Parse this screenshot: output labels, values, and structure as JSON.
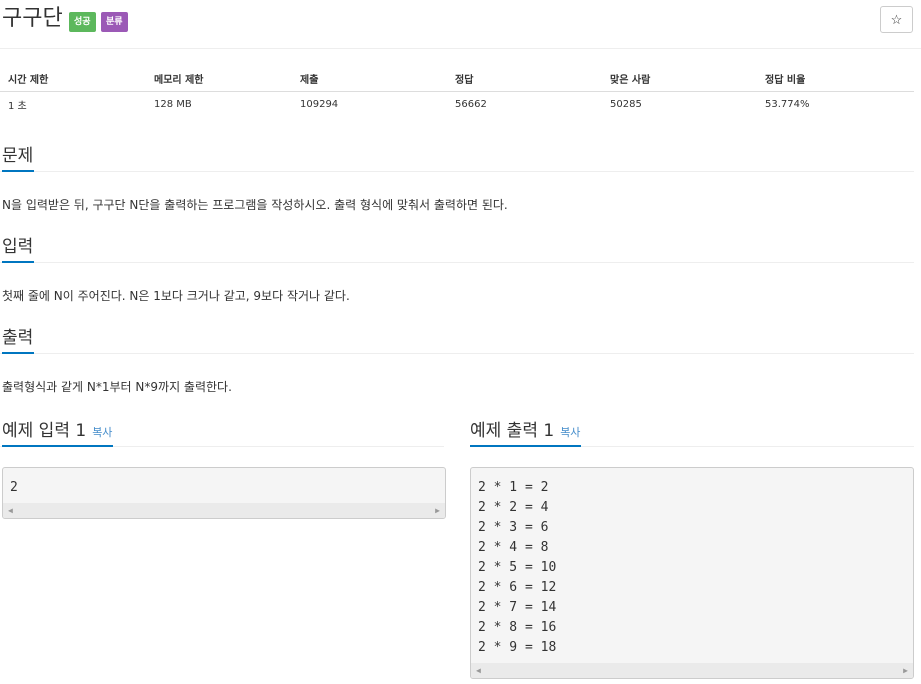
{
  "problem": {
    "title": "구구단",
    "badges": {
      "success": "성공",
      "category": "분류"
    },
    "star": "☆"
  },
  "info_table": {
    "headers": [
      "시간 제한",
      "메모리 제한",
      "제출",
      "정답",
      "맞은 사람",
      "정답 비율"
    ],
    "values": [
      "1 초",
      "128 MB",
      "109294",
      "56662",
      "50285",
      "53.774%"
    ]
  },
  "sections": {
    "description": {
      "title": "문제",
      "text": "N을 입력받은 뒤, 구구단 N단을 출력하는 프로그램을 작성하시오. 출력 형식에 맞춰서 출력하면 된다."
    },
    "input": {
      "title": "입력",
      "text": "첫째 줄에 N이 주어진다. N은 1보다 크거나 같고, 9보다 작거나 같다."
    },
    "output": {
      "title": "출력",
      "text": "출력형식과 같게 N*1부터 N*9까지 출력한다."
    }
  },
  "samples": {
    "input": {
      "title": "예제 입력 1",
      "copy": "복사",
      "content": "2"
    },
    "output": {
      "title": "예제 출력 1",
      "copy": "복사",
      "content": "2 * 1 = 2\n2 * 2 = 4\n2 * 3 = 6\n2 * 4 = 8\n2 * 5 = 10\n2 * 6 = 12\n2 * 7 = 14\n2 * 8 = 16\n2 * 9 = 18"
    }
  },
  "colors": {
    "success_badge": "#5cb85c",
    "category_badge": "#9b59b6",
    "accent_underline": "#0076c0",
    "link": "#428bca"
  }
}
